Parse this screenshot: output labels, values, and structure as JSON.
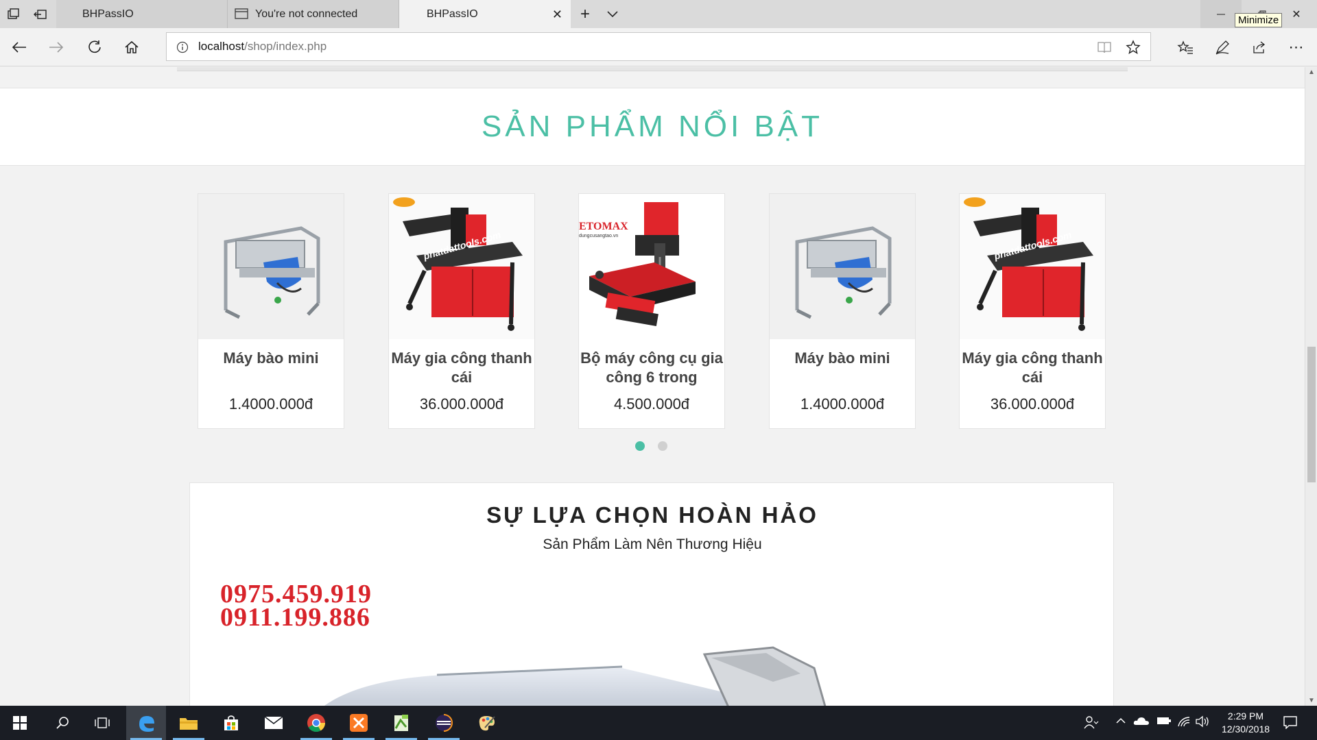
{
  "browser": {
    "tabs": [
      {
        "title": "BHPassIO",
        "active": false
      },
      {
        "title": "You're not connected",
        "active": false
      },
      {
        "title": "BHPassIO",
        "active": true
      }
    ],
    "tooltip": "Minimize",
    "url_host": "localhost",
    "url_path": "/shop/index.php"
  },
  "featured": {
    "title": "SẢN PHẨM NỔI BẬT",
    "products": [
      {
        "name": "Máy bào mini",
        "price": "1.4000.000đ",
        "image": "mini-planer"
      },
      {
        "name": "Máy gia công thanh cái",
        "price": "36.000.000đ",
        "image": "busbar-machine"
      },
      {
        "name": "Bộ máy công cụ gia công 6 trong",
        "price": "4.500.000đ",
        "image": "six-in-one-tool"
      },
      {
        "name": "Máy bào mini",
        "price": "1.4000.000đ",
        "image": "mini-planer"
      },
      {
        "name": "Máy gia công thanh cái",
        "price": "36.000.000đ",
        "image": "busbar-machine"
      }
    ],
    "carousel": {
      "pages": 2,
      "active_page": 1
    },
    "image_text": {
      "etomax": "ETOMAX",
      "etomax_sub": "dungcusangtao.vn",
      "watermark": "phatdattools.com"
    }
  },
  "perfect_choice": {
    "title": "SỰ LỰA CHỌN HOÀN HẢO",
    "subtitle": "Sản Phẩm Làm Nên Thương Hiệu",
    "phones": [
      "0975.459.919",
      "0911.199.886"
    ]
  },
  "taskbar": {
    "clock_time": "2:29 PM",
    "clock_date": "12/30/2018",
    "apps": [
      "start-icon",
      "search-icon",
      "task-view-icon",
      "edge-icon",
      "file-explorer-icon",
      "store-icon",
      "mail-icon",
      "chrome-icon",
      "xampp-icon",
      "notepad-plus-icon",
      "eclipse-icon",
      "paint-icon"
    ]
  },
  "colors": {
    "accent_teal": "#4bbfa5",
    "phone_red": "#d8232a",
    "machine_red": "#e0252b"
  }
}
